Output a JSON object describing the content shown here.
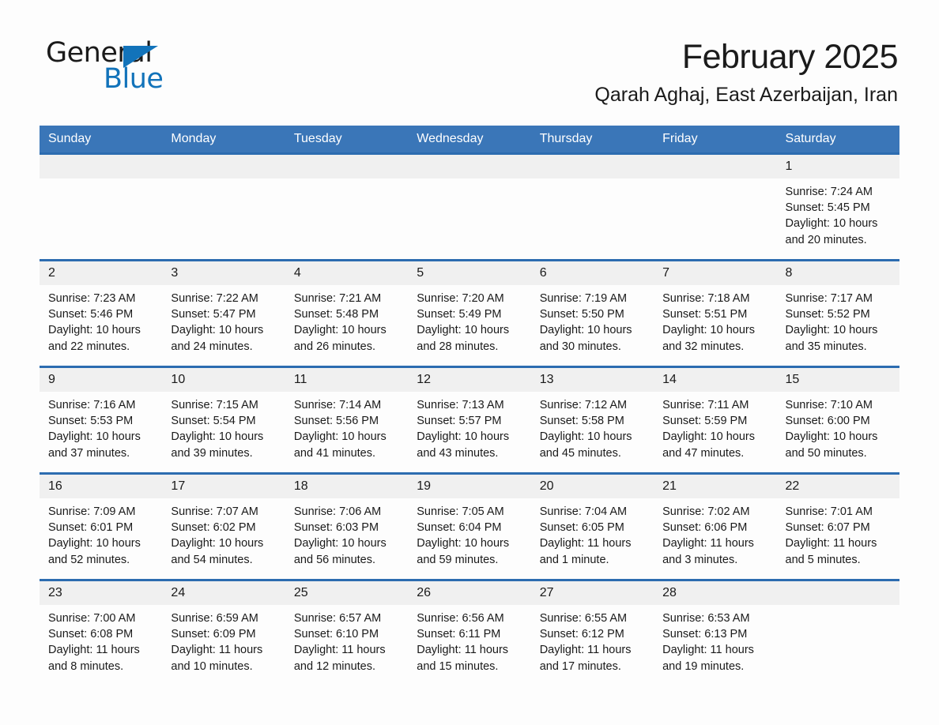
{
  "brand": {
    "name_part1": "General",
    "name_part2": "Blue",
    "triangle_color": "#1273ba"
  },
  "header": {
    "title": "February 2025",
    "location": "Qarah Aghaj, East Azerbaijan, Iran"
  },
  "colors": {
    "header_blue": "#3a76b8",
    "row_border_blue": "#2c6cb0",
    "daynum_background": "#f0f0f0",
    "text": "#1a1a1a"
  },
  "weekdays": [
    "Sunday",
    "Monday",
    "Tuesday",
    "Wednesday",
    "Thursday",
    "Friday",
    "Saturday"
  ],
  "weeks": [
    [
      {
        "day": "",
        "sunrise": "",
        "sunset": "",
        "daylight": ""
      },
      {
        "day": "",
        "sunrise": "",
        "sunset": "",
        "daylight": ""
      },
      {
        "day": "",
        "sunrise": "",
        "sunset": "",
        "daylight": ""
      },
      {
        "day": "",
        "sunrise": "",
        "sunset": "",
        "daylight": ""
      },
      {
        "day": "",
        "sunrise": "",
        "sunset": "",
        "daylight": ""
      },
      {
        "day": "",
        "sunrise": "",
        "sunset": "",
        "daylight": ""
      },
      {
        "day": "1",
        "sunrise": "Sunrise: 7:24 AM",
        "sunset": "Sunset: 5:45 PM",
        "daylight": "Daylight: 10 hours and 20 minutes."
      }
    ],
    [
      {
        "day": "2",
        "sunrise": "Sunrise: 7:23 AM",
        "sunset": "Sunset: 5:46 PM",
        "daylight": "Daylight: 10 hours and 22 minutes."
      },
      {
        "day": "3",
        "sunrise": "Sunrise: 7:22 AM",
        "sunset": "Sunset: 5:47 PM",
        "daylight": "Daylight: 10 hours and 24 minutes."
      },
      {
        "day": "4",
        "sunrise": "Sunrise: 7:21 AM",
        "sunset": "Sunset: 5:48 PM",
        "daylight": "Daylight: 10 hours and 26 minutes."
      },
      {
        "day": "5",
        "sunrise": "Sunrise: 7:20 AM",
        "sunset": "Sunset: 5:49 PM",
        "daylight": "Daylight: 10 hours and 28 minutes."
      },
      {
        "day": "6",
        "sunrise": "Sunrise: 7:19 AM",
        "sunset": "Sunset: 5:50 PM",
        "daylight": "Daylight: 10 hours and 30 minutes."
      },
      {
        "day": "7",
        "sunrise": "Sunrise: 7:18 AM",
        "sunset": "Sunset: 5:51 PM",
        "daylight": "Daylight: 10 hours and 32 minutes."
      },
      {
        "day": "8",
        "sunrise": "Sunrise: 7:17 AM",
        "sunset": "Sunset: 5:52 PM",
        "daylight": "Daylight: 10 hours and 35 minutes."
      }
    ],
    [
      {
        "day": "9",
        "sunrise": "Sunrise: 7:16 AM",
        "sunset": "Sunset: 5:53 PM",
        "daylight": "Daylight: 10 hours and 37 minutes."
      },
      {
        "day": "10",
        "sunrise": "Sunrise: 7:15 AM",
        "sunset": "Sunset: 5:54 PM",
        "daylight": "Daylight: 10 hours and 39 minutes."
      },
      {
        "day": "11",
        "sunrise": "Sunrise: 7:14 AM",
        "sunset": "Sunset: 5:56 PM",
        "daylight": "Daylight: 10 hours and 41 minutes."
      },
      {
        "day": "12",
        "sunrise": "Sunrise: 7:13 AM",
        "sunset": "Sunset: 5:57 PM",
        "daylight": "Daylight: 10 hours and 43 minutes."
      },
      {
        "day": "13",
        "sunrise": "Sunrise: 7:12 AM",
        "sunset": "Sunset: 5:58 PM",
        "daylight": "Daylight: 10 hours and 45 minutes."
      },
      {
        "day": "14",
        "sunrise": "Sunrise: 7:11 AM",
        "sunset": "Sunset: 5:59 PM",
        "daylight": "Daylight: 10 hours and 47 minutes."
      },
      {
        "day": "15",
        "sunrise": "Sunrise: 7:10 AM",
        "sunset": "Sunset: 6:00 PM",
        "daylight": "Daylight: 10 hours and 50 minutes."
      }
    ],
    [
      {
        "day": "16",
        "sunrise": "Sunrise: 7:09 AM",
        "sunset": "Sunset: 6:01 PM",
        "daylight": "Daylight: 10 hours and 52 minutes."
      },
      {
        "day": "17",
        "sunrise": "Sunrise: 7:07 AM",
        "sunset": "Sunset: 6:02 PM",
        "daylight": "Daylight: 10 hours and 54 minutes."
      },
      {
        "day": "18",
        "sunrise": "Sunrise: 7:06 AM",
        "sunset": "Sunset: 6:03 PM",
        "daylight": "Daylight: 10 hours and 56 minutes."
      },
      {
        "day": "19",
        "sunrise": "Sunrise: 7:05 AM",
        "sunset": "Sunset: 6:04 PM",
        "daylight": "Daylight: 10 hours and 59 minutes."
      },
      {
        "day": "20",
        "sunrise": "Sunrise: 7:04 AM",
        "sunset": "Sunset: 6:05 PM",
        "daylight": "Daylight: 11 hours and 1 minute."
      },
      {
        "day": "21",
        "sunrise": "Sunrise: 7:02 AM",
        "sunset": "Sunset: 6:06 PM",
        "daylight": "Daylight: 11 hours and 3 minutes."
      },
      {
        "day": "22",
        "sunrise": "Sunrise: 7:01 AM",
        "sunset": "Sunset: 6:07 PM",
        "daylight": "Daylight: 11 hours and 5 minutes."
      }
    ],
    [
      {
        "day": "23",
        "sunrise": "Sunrise: 7:00 AM",
        "sunset": "Sunset: 6:08 PM",
        "daylight": "Daylight: 11 hours and 8 minutes."
      },
      {
        "day": "24",
        "sunrise": "Sunrise: 6:59 AM",
        "sunset": "Sunset: 6:09 PM",
        "daylight": "Daylight: 11 hours and 10 minutes."
      },
      {
        "day": "25",
        "sunrise": "Sunrise: 6:57 AM",
        "sunset": "Sunset: 6:10 PM",
        "daylight": "Daylight: 11 hours and 12 minutes."
      },
      {
        "day": "26",
        "sunrise": "Sunrise: 6:56 AM",
        "sunset": "Sunset: 6:11 PM",
        "daylight": "Daylight: 11 hours and 15 minutes."
      },
      {
        "day": "27",
        "sunrise": "Sunrise: 6:55 AM",
        "sunset": "Sunset: 6:12 PM",
        "daylight": "Daylight: 11 hours and 17 minutes."
      },
      {
        "day": "28",
        "sunrise": "Sunrise: 6:53 AM",
        "sunset": "Sunset: 6:13 PM",
        "daylight": "Daylight: 11 hours and 19 minutes."
      },
      {
        "day": "",
        "sunrise": "",
        "sunset": "",
        "daylight": ""
      }
    ]
  ]
}
